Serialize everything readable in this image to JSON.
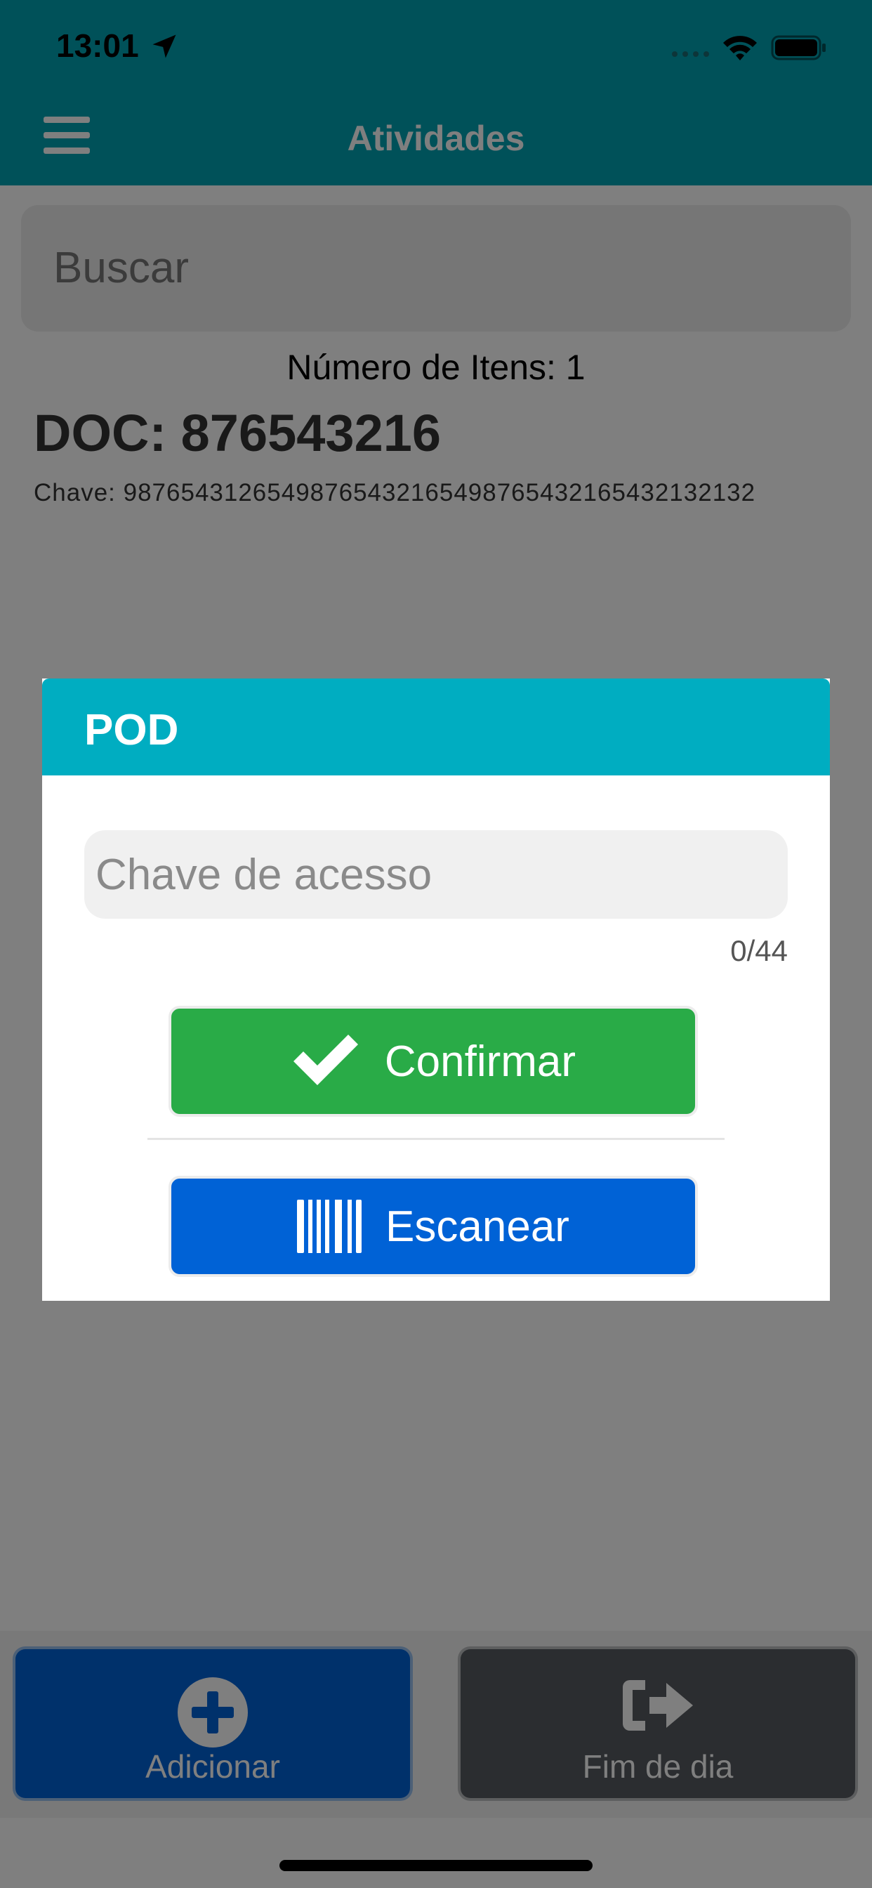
{
  "status_bar": {
    "time": "13:01",
    "icons": [
      "location-arrow-icon",
      "signal-icon",
      "wifi-icon",
      "battery-icon"
    ]
  },
  "nav": {
    "title": "Atividades",
    "menu_icon": "hamburger-menu-icon"
  },
  "search": {
    "placeholder": "Buscar"
  },
  "list": {
    "item_count": "Número de Itens: 1",
    "doc_title": "DOC: 876543216",
    "doc_key": "Chave: 98765431265498765432165498765432165432132132"
  },
  "modal": {
    "title": "POD",
    "input_placeholder": "Chave de acesso",
    "input_value": "",
    "counter": "0/44",
    "confirm_label": "Confirmar",
    "confirm_icon": "checkmark-icon",
    "scan_label": "Escanear",
    "scan_icon": "barcode-icon"
  },
  "bottom_bar": {
    "add_label": "Adicionar",
    "add_icon": "plus-circle-icon",
    "end_label": "Fim de dia",
    "end_icon": "sign-out-icon"
  },
  "colors": {
    "header": "#00a3b3",
    "modal_header": "#00adc1",
    "confirm": "#29ab47",
    "scan": "#0062d6",
    "end_day": "#565b60"
  }
}
